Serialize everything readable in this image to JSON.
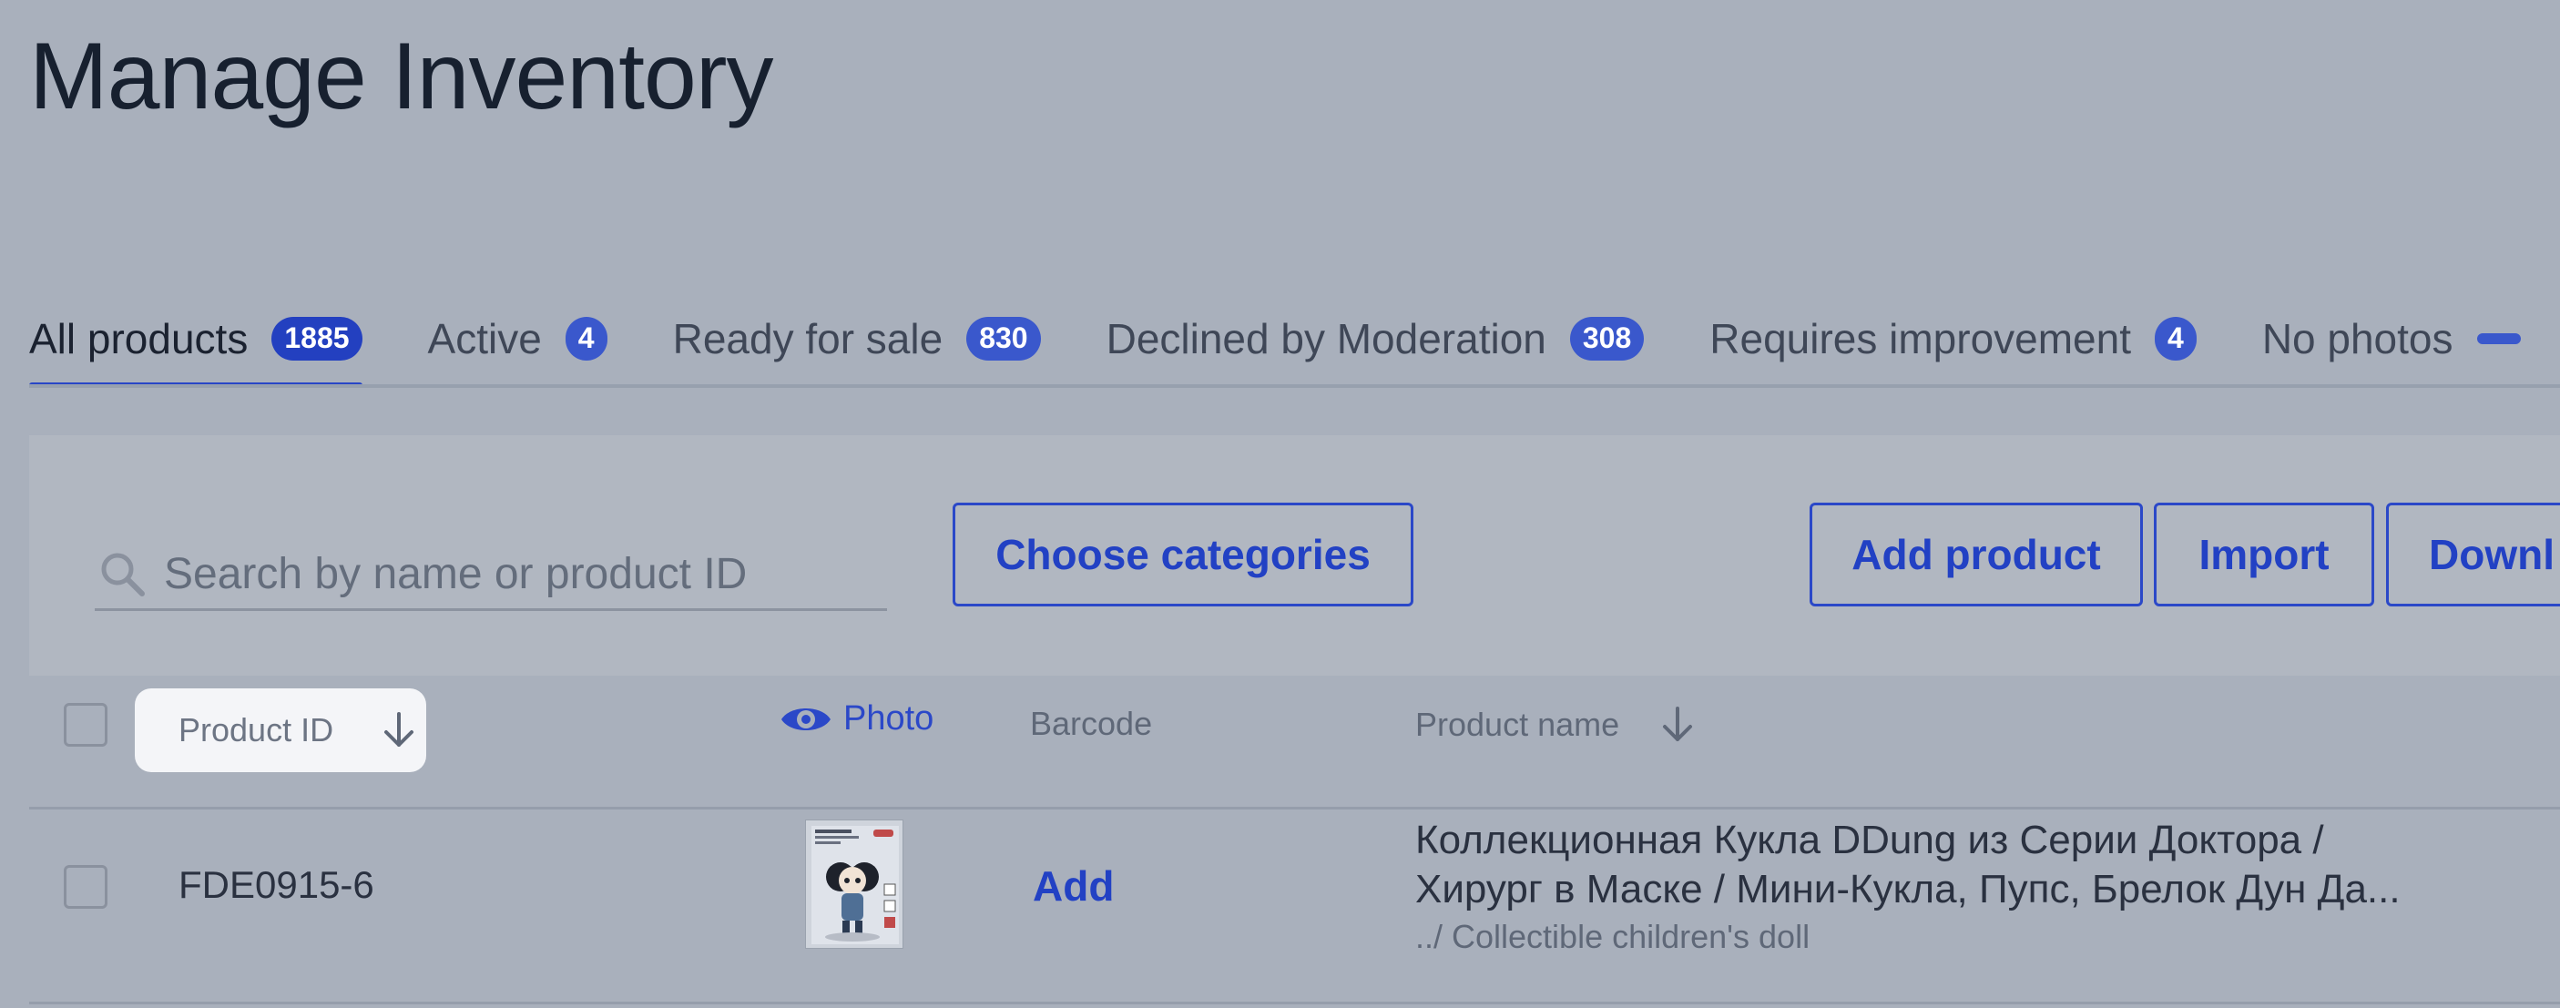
{
  "header": {
    "title": "Manage Inventory"
  },
  "tabs": [
    {
      "label": "All products",
      "count": "1885",
      "active": true
    },
    {
      "label": "Active",
      "count": "4"
    },
    {
      "label": "Ready for sale",
      "count": "830"
    },
    {
      "label": "Declined by Moderation",
      "count": "308"
    },
    {
      "label": "Requires improvement",
      "count": "4"
    },
    {
      "label": "No photos",
      "count": ""
    }
  ],
  "toolbar": {
    "search_placeholder": "Search by name or product ID",
    "search_value": "",
    "choose_categories_label": "Choose categories",
    "add_product_label": "Add product",
    "import_label": "Import",
    "download_label": "Downl"
  },
  "table": {
    "columns": {
      "product_id": "Product ID",
      "photo": "Photo",
      "barcode": "Barcode",
      "product_name": "Product name"
    },
    "rows": [
      {
        "product_id": "FDE0915-6",
        "barcode_action": "Add",
        "name_line1": "Коллекционная Кукла DDung из Серии Доктора /",
        "name_line2": "Хирург в Маске / Мини-Кукла, Пупс, Брелок Дун Да...",
        "category": "../ Collectible children's doll"
      }
    ]
  },
  "icons": {
    "search": "search-icon",
    "sort": "arrow-down-icon",
    "photo": "eye-icon"
  },
  "colors": {
    "accent": "#2241c4",
    "background": "#a9b0bc",
    "badge": "#3a58cc"
  }
}
